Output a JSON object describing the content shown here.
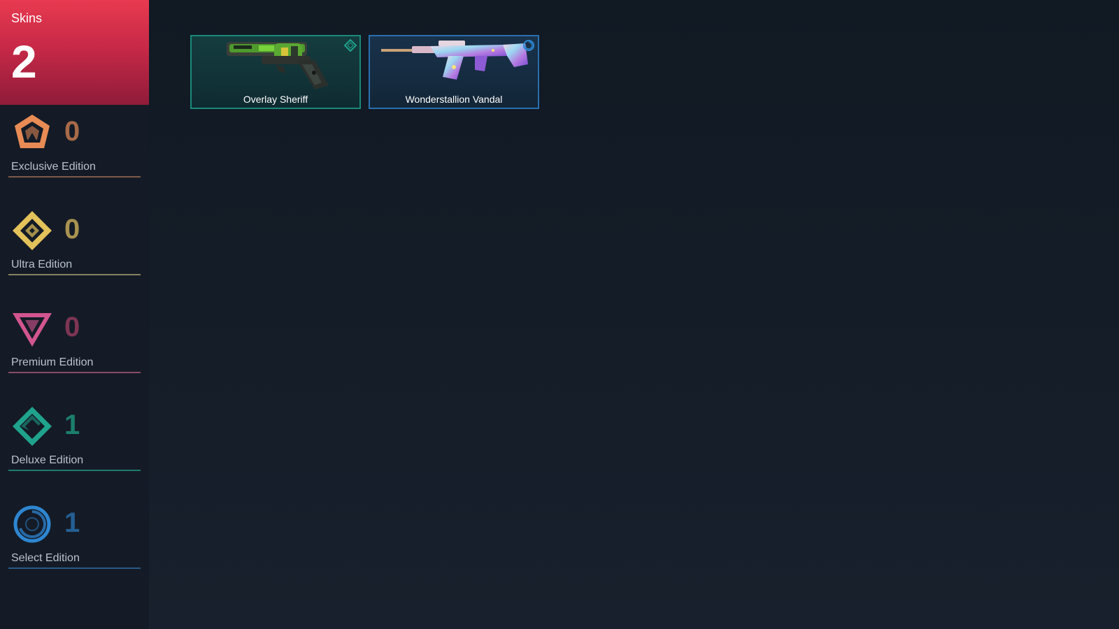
{
  "summary": {
    "label": "Skins",
    "count": "2"
  },
  "tiers": [
    {
      "name": "Exclusive Edition",
      "count": "0",
      "icon": "exclusive-tier-icon",
      "color": "#e88b55"
    },
    {
      "name": "Ultra Edition",
      "count": "0",
      "icon": "ultra-tier-icon",
      "color": "#e3c25a"
    },
    {
      "name": "Premium Edition",
      "count": "0",
      "icon": "premium-tier-icon",
      "color": "#d25590"
    },
    {
      "name": "Deluxe Edition",
      "count": "1",
      "icon": "deluxe-tier-icon",
      "color": "#1fa38c"
    },
    {
      "name": "Select Edition",
      "count": "1",
      "icon": "select-tier-icon",
      "color": "#2e86d1"
    }
  ],
  "skins": [
    {
      "name": "Overlay Sheriff",
      "tier": "Deluxe Edition",
      "icon": "deluxe-tier-icon",
      "weapon_icon": "sheriff-pistol-icon"
    },
    {
      "name": "Wonderstallion Vandal",
      "tier": "Select Edition",
      "icon": "select-tier-icon",
      "weapon_icon": "vandal-rifle-icon"
    }
  ]
}
